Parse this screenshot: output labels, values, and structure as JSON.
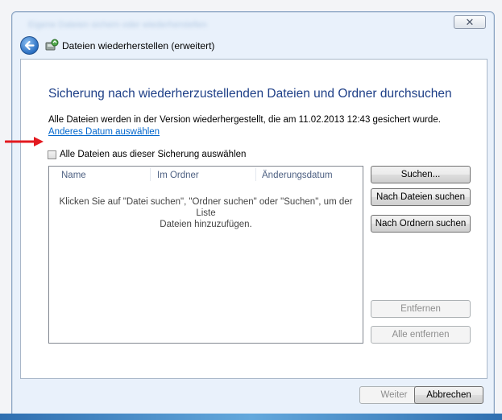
{
  "window": {
    "blurred_title": "Eigene Dateien sichern oder wiederherstellen",
    "close_glyph": "✕"
  },
  "nav": {
    "title": "Dateien wiederherstellen (erweitert)"
  },
  "panel": {
    "heading": "Sicherung nach wiederherzustellenden Dateien und Ordner durchsuchen",
    "info_text": "Alle Dateien werden in der Version wiederhergestellt, die am 11.02.2013 12:43 gesichert wurde.",
    "date_link": "Anderes Datum auswählen",
    "select_all_label": "Alle Dateien aus dieser Sicherung auswählen"
  },
  "list": {
    "columns": [
      "Name",
      "Im Ordner",
      "Änderungsdatum"
    ],
    "empty_line1": "Klicken Sie auf \"Datei suchen\", \"Ordner suchen\" oder \"Suchen\", um der Liste",
    "empty_line2": "Dateien hinzuzufügen."
  },
  "buttons": {
    "search": "Suchen...",
    "search_files": "Nach Dateien suchen",
    "search_folders": "Nach Ordnern suchen",
    "remove": "Entfernen",
    "remove_all": "Alle entfernen"
  },
  "footer": {
    "next": "Weiter",
    "cancel": "Abbrechen"
  },
  "colors": {
    "heading": "#1e3f87",
    "link": "#0066cc",
    "arrow": "#e3191f"
  }
}
